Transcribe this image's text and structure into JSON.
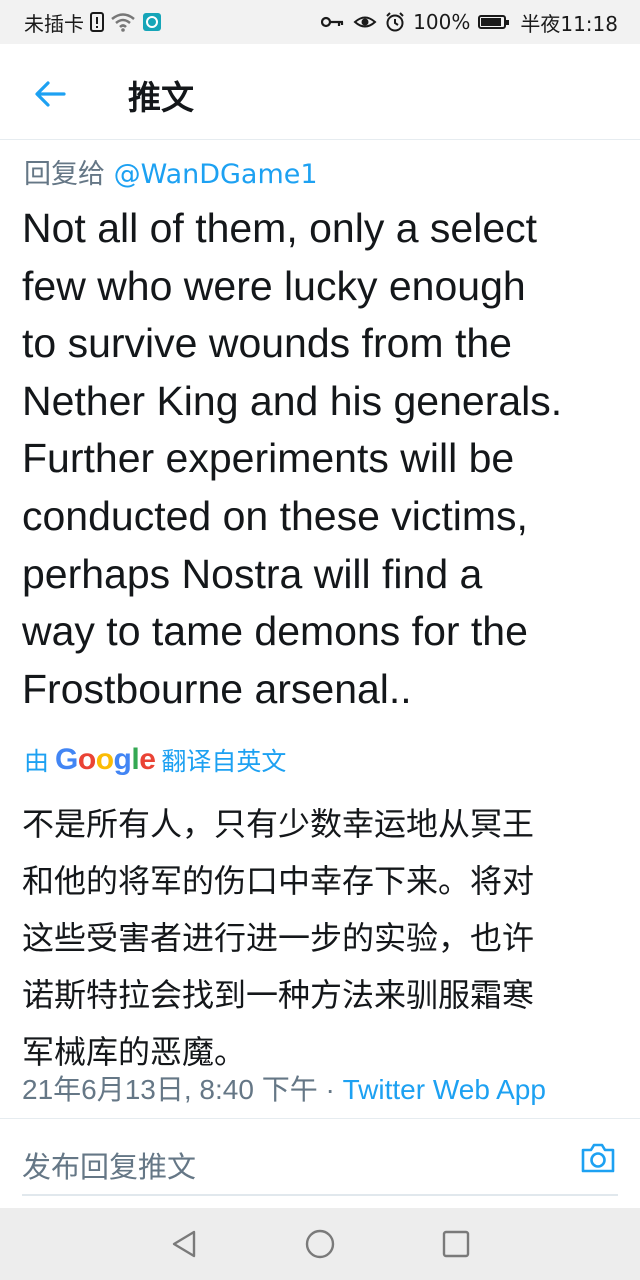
{
  "status_bar": {
    "carrier": "未插卡",
    "battery": "100%",
    "time": "半夜11:18"
  },
  "header": {
    "title": "推文"
  },
  "tweet": {
    "reply_prefix": "回复给",
    "reply_handle": "@WanDGame1",
    "lines": [
      "Not all of them, only a select",
      "few who were lucky enough",
      "to survive wounds from the",
      "Nether King and his generals.",
      "Further experiments will be",
      "conducted on these victims,",
      "perhaps Nostra will find a",
      "way to tame demons for the",
      "Frostbourne arsenal.."
    ],
    "translate_prefix": "由",
    "translate_provider": "Google",
    "translate_suffix": "翻译自英文",
    "translated_lines": [
      "不是所有人，只有少数幸运地从冥王",
      "和他的将军的伤口中幸存下来。将对",
      "这些受害者进行进一步的实验，也许",
      "诺斯特拉会找到一种方法来驯服霜寒",
      "军械库的恶魔。"
    ],
    "timestamp": "21年6月13日, 8:40 下午 · ",
    "source_app": "Twitter Web App"
  },
  "reply_bar": {
    "placeholder": "发布回复推文"
  },
  "colors": {
    "accent": "#1da1f2",
    "text": "#14171a",
    "secondary": "#657786"
  },
  "icons": {
    "back": "arrow-left-icon",
    "camera": "camera-icon",
    "nav_back": "triangle-back-icon",
    "nav_home": "circle-home-icon",
    "nav_recent": "square-recent-icon"
  }
}
